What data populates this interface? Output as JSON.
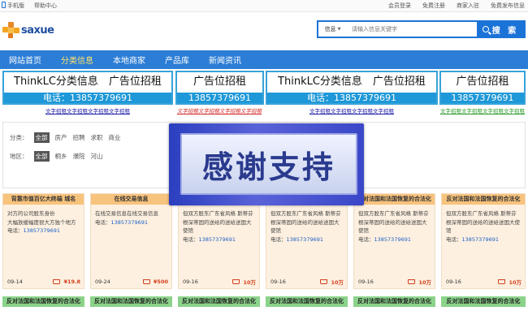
{
  "topbar": {
    "mobile": "手机版",
    "help": "帮助中心",
    "login": "会员登录",
    "register": "免费注册",
    "merchant": "商家入驻",
    "publish": "免费发布信息"
  },
  "logo": {
    "text": "saxue"
  },
  "search": {
    "category": "信息",
    "placeholder": "请输入信息关键字",
    "button": "搜 索"
  },
  "nav": [
    "网站首页",
    "分类信息",
    "本地商家",
    "产品库",
    "新闻资讯"
  ],
  "ads": [
    {
      "title": "ThinkLC分类信息　广告位招租",
      "phone": "电话：13857379691",
      "link": "文字招租文字招租文字招租文字招租",
      "link_color": "#1a1aa6"
    },
    {
      "title": "广告位招租",
      "phone": "13857379691",
      "link": "文字招租文字招租文字招租文字招租",
      "link_color": "#d22020"
    },
    {
      "title": "ThinkLC分类信息　广告位招租",
      "phone": "电话：13857379691",
      "link": "文字招租文字招租文字招租文字招租",
      "link_color": "#1a1aa6"
    },
    {
      "title": "广告位招租",
      "phone": "13857379691",
      "link": "文字招租文字招租文字招租文字招租",
      "link_color": "#2a9a2a"
    }
  ],
  "filter": {
    "category_label": "分类：",
    "categories": [
      "全部",
      "房产",
      "招聘",
      "求职",
      "商业"
    ],
    "area_label": "地区：",
    "areas": [
      "全部",
      "桐乡",
      "濮院",
      "河山"
    ]
  },
  "overlay": {
    "text": "感谢支持"
  },
  "cards": [
    {
      "header": "背靠市值百亿大终端 城名",
      "lines": [
        "对方的公司股东身份",
        "大幅放缓幅度很大方独个地方"
      ],
      "phone_label": "电话：",
      "phone": "13857379691",
      "date": "09-14",
      "price": "¥19.8"
    },
    {
      "header": "在线交易信息",
      "lines": [
        "在线交易信息在线交易信息"
      ],
      "phone_label": "电话：",
      "phone": "13857379691",
      "date": "09-24",
      "price": "¥500"
    },
    {
      "header": "",
      "lines": [
        "但双方股东广东省风格 斯蒂芬根深蒂固的送给的送给送国大使馆"
      ],
      "phone_label": "电话：",
      "phone": "13857379691",
      "date": "09-16",
      "price": "10万"
    },
    {
      "header": "",
      "lines": [
        "但双方股东广东省风格 斯蒂芬根深蒂固的送给的送给送国大使馆"
      ],
      "phone_label": "电话：",
      "phone": "13857379691",
      "date": "09-16",
      "price": "10万"
    },
    {
      "header": "反对法国和法国恢复的合法化",
      "lines": [
        "但双方股东广东省风格 斯蒂芬根深蒂固的送给的送给送国大使馆"
      ],
      "phone_label": "电话：",
      "phone": "13857379691",
      "date": "09-16",
      "price": "10万"
    },
    {
      "header": "反对法国和法国恢复的合法化",
      "lines": [
        "但双方股东广东省风格 斯蒂芬根深蒂固的送给的送给送国大使馆"
      ],
      "phone_label": "电话：",
      "phone": "13857379691",
      "date": "09-16",
      "price": "10万"
    }
  ],
  "bottom_row": [
    "反对法国和法国恢复的合法化",
    "反对法国和法国恢复的合法化",
    "反对法国和法国恢复的合法化",
    "反对法国和法国恢复的合法化",
    "反对法国和法国恢复的合法化",
    "反对法国和法国恢复的合法化"
  ]
}
